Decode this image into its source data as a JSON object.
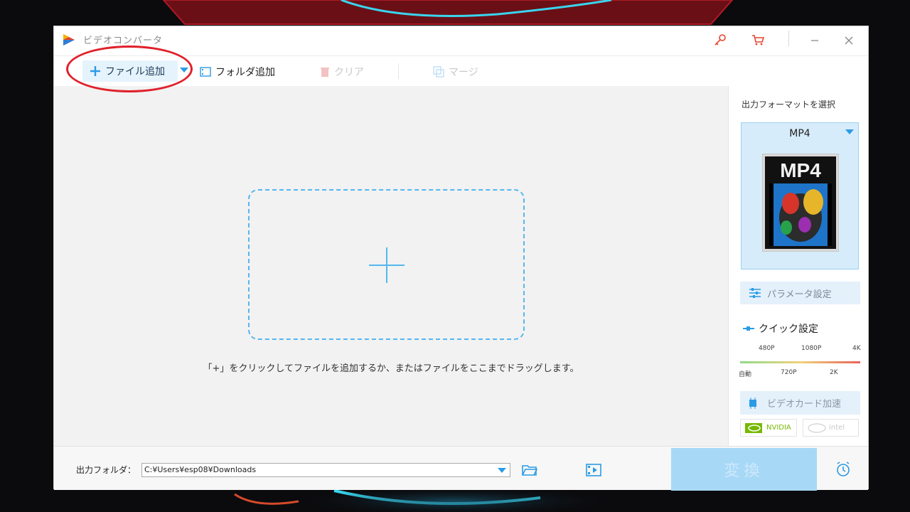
{
  "window": {
    "title": "ビデオコンバータ"
  },
  "toolbar": {
    "add_file_label": "ファイル追加",
    "add_folder_label": "フォルダ追加",
    "clear_label": "クリア",
    "merge_label": "マージ"
  },
  "main": {
    "hint": "「+」をクリックしてファイルを追加するか、またはファイルをここまでドラッグします。"
  },
  "output_panel": {
    "title": "出力フォーマットを選択",
    "format": "MP4",
    "thumbnail_text": "MP4",
    "param_button_label": "パラメータ設定",
    "quick_settings_title": "クイック設定",
    "quality_labels_top": [
      "480P",
      "1080P",
      "4K"
    ],
    "quality_labels_bottom": [
      "自動",
      "720P",
      "2K"
    ],
    "selected_quality": "自動",
    "gpu_button_label": "ビデオカード加速",
    "gpu_vendors": [
      "NVIDIA",
      "intel"
    ]
  },
  "bottom": {
    "output_folder_label": "出力フォルダ：",
    "output_path": "C:¥Users¥esp08¥Downloads",
    "convert_label": "変換"
  },
  "colors": {
    "accent": "#2a9be5",
    "highlight_ring": "#e0202a",
    "convert_disabled": "#a7d9f7",
    "nvidia_green": "#76b900"
  }
}
